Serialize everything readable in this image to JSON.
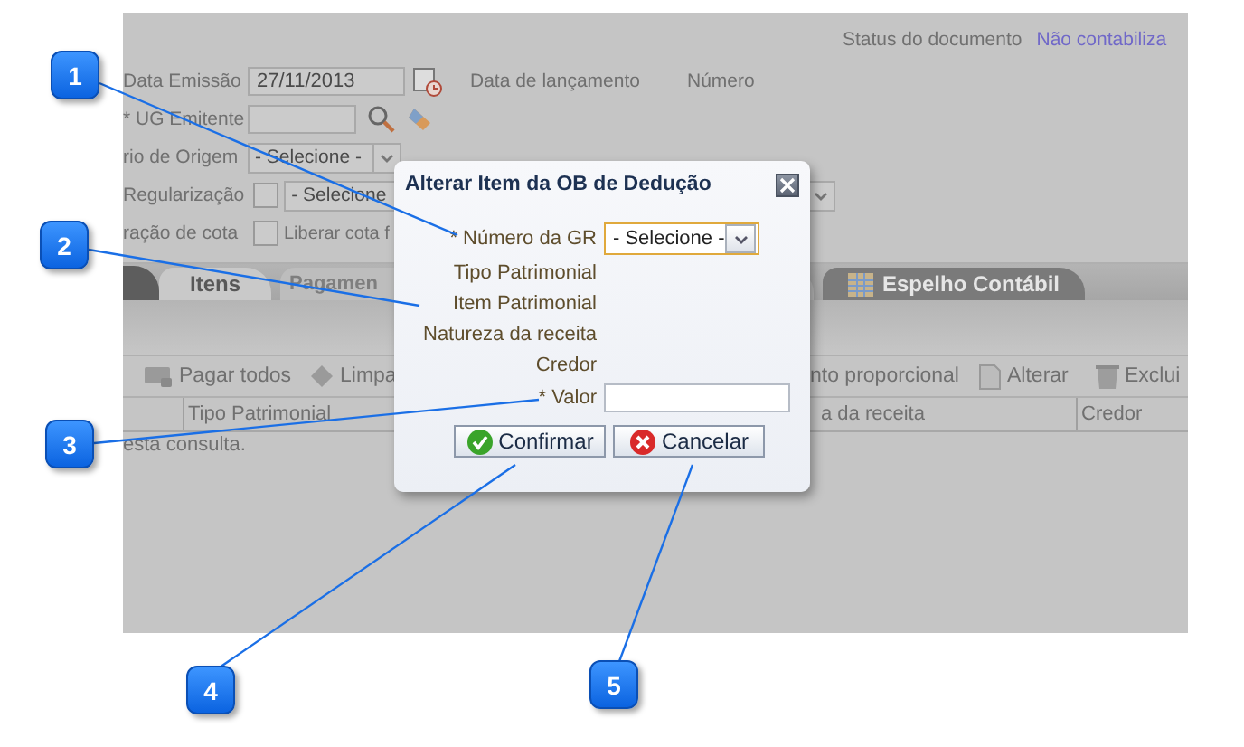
{
  "screen": {
    "status": {
      "label": "Status do documento",
      "value": "Não contabiliza"
    },
    "form_rows": [
      {
        "kind": "date",
        "label": "Data Emissão",
        "value": "27/11/2013",
        "extra_labels": [
          "Data de lançamento",
          "Número"
        ]
      },
      {
        "kind": "lookup",
        "label": "* UG Emitente"
      },
      {
        "kind": "select",
        "label": "rio de Origem",
        "value": "- Selecione -"
      },
      {
        "kind": "check-select",
        "label": "Regularização",
        "checked": false,
        "value": "- Selecione"
      },
      {
        "kind": "check-text",
        "label": "ração de cota",
        "checked": false,
        "text": "Liberar cota f"
      }
    ],
    "tabs": [
      {
        "label": "Itens",
        "kind": "plain",
        "selected": true,
        "disabled": false
      },
      {
        "label": "Pagamen",
        "kind": "plain",
        "selected": false,
        "disabled": true
      },
      {
        "label": "Espelho Contábil",
        "kind": "table",
        "selected": false,
        "disabled": false
      }
    ],
    "toolbar": [
      {
        "kind": "pay",
        "label": "Pagar todos"
      },
      {
        "kind": "clear",
        "label": "Limpa"
      },
      {
        "kind": "text",
        "label": "nto proporcional"
      },
      {
        "kind": "edit",
        "label": "Alterar"
      },
      {
        "kind": "delete",
        "label": "Exclui"
      }
    ],
    "columns": [
      {
        "label": "Tipo Patrimonial"
      },
      {
        "label": "a da receita"
      },
      {
        "label": "Credor"
      }
    ],
    "empty_message": "esta consulta."
  },
  "dialog": {
    "title": "Alterar Item da OB de Dedução",
    "fields": [
      {
        "kind": "select",
        "label": "* Número da GR",
        "value": "- Selecione -",
        "focused": true
      },
      {
        "kind": "text",
        "label": "Tipo Patrimonial"
      },
      {
        "kind": "text",
        "label": "Item Patrimonial"
      },
      {
        "kind": "text",
        "label": "Natureza da receita"
      },
      {
        "kind": "text",
        "label": "Credor"
      },
      {
        "kind": "input",
        "label": "* Valor"
      }
    ],
    "buttons": [
      {
        "kind": "confirm",
        "label": "Confirmar"
      },
      {
        "kind": "cancel",
        "label": "Cancelar"
      }
    ]
  },
  "callouts": [
    {
      "number": "1"
    },
    {
      "number": "2"
    },
    {
      "number": "3"
    },
    {
      "number": "4"
    },
    {
      "number": "5"
    }
  ]
}
